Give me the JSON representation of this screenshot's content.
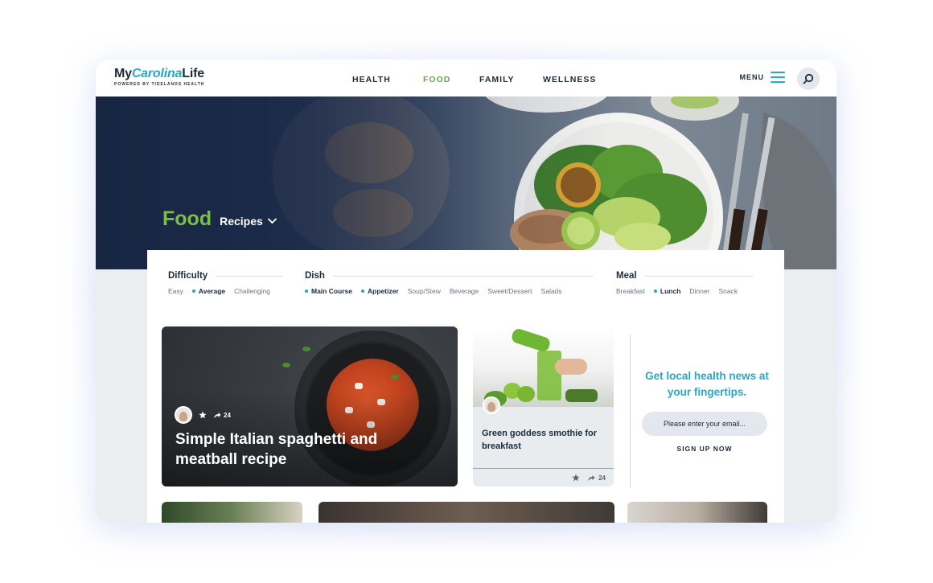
{
  "logo": {
    "part1": "My",
    "part2": "Carolina",
    "part3": "Life",
    "tagline": "POWERED BY TIDELANDS HEALTH"
  },
  "nav": [
    {
      "label": "HEALTH"
    },
    {
      "label": "FOOD"
    },
    {
      "label": "FAMILY"
    },
    {
      "label": "WELLNESS"
    }
  ],
  "menu": {
    "label": "MENU"
  },
  "hero": {
    "title": "Food",
    "subtitle": "Recipes"
  },
  "filters": {
    "difficulty": {
      "title": "Difficulty",
      "options": [
        "Easy",
        "Average",
        "Challenging"
      ]
    },
    "dish": {
      "title": "Dish",
      "options": [
        "Main Course",
        "Appetizer",
        "Soup/Stew",
        "Beverage",
        "Sweet/Dessert",
        "Salads"
      ]
    },
    "meal": {
      "title": "Meal",
      "options": [
        "Breakfast",
        "Lunch",
        "Dinner",
        "Snack"
      ]
    }
  },
  "cards": {
    "featured": {
      "title": "Simple Italian spaghetti and meatball recipe",
      "shares": "24"
    },
    "smoothie": {
      "title": "Green goddess smothie for breakfast",
      "shares": "24"
    }
  },
  "signup": {
    "title": "Get local health news at your fingertips.",
    "placeholder": "Please enter your email...",
    "button": "SIGN UP NOW"
  },
  "colors": {
    "accent": "#2ba7c2",
    "food_green": "#6aa84f",
    "navy": "#1c2b3a"
  }
}
